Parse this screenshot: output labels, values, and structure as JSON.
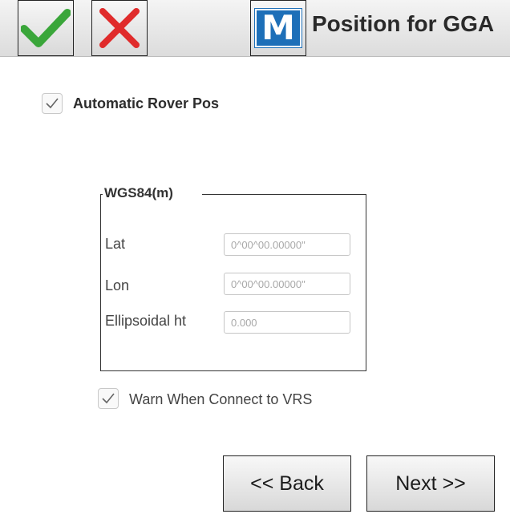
{
  "window": {
    "title": "Position for GGA"
  },
  "toolbar": {
    "ok_icon": "checkmark-icon",
    "cancel_icon": "close-icon",
    "menu_logo_letter": "M",
    "colors": {
      "ok": "#3aa63a",
      "cancel": "#e02b2b",
      "logo": "#1d6fb8"
    }
  },
  "options": {
    "automatic_rover_pos": {
      "label": "Automatic Rover Pos",
      "checked": true
    },
    "warn_vrs": {
      "label": "Warn When Connect to VRS",
      "checked": true
    }
  },
  "coordinates": {
    "group_title": "WGS84(m)",
    "lat": {
      "label": "Lat",
      "placeholder": "0^00^00.00000\""
    },
    "lon": {
      "label": "Lon",
      "placeholder": "0^00^00.00000\""
    },
    "height": {
      "label": "Ellipsoidal ht",
      "placeholder": "0.000"
    }
  },
  "nav": {
    "back_label": "<< Back",
    "next_label": "Next >>"
  }
}
